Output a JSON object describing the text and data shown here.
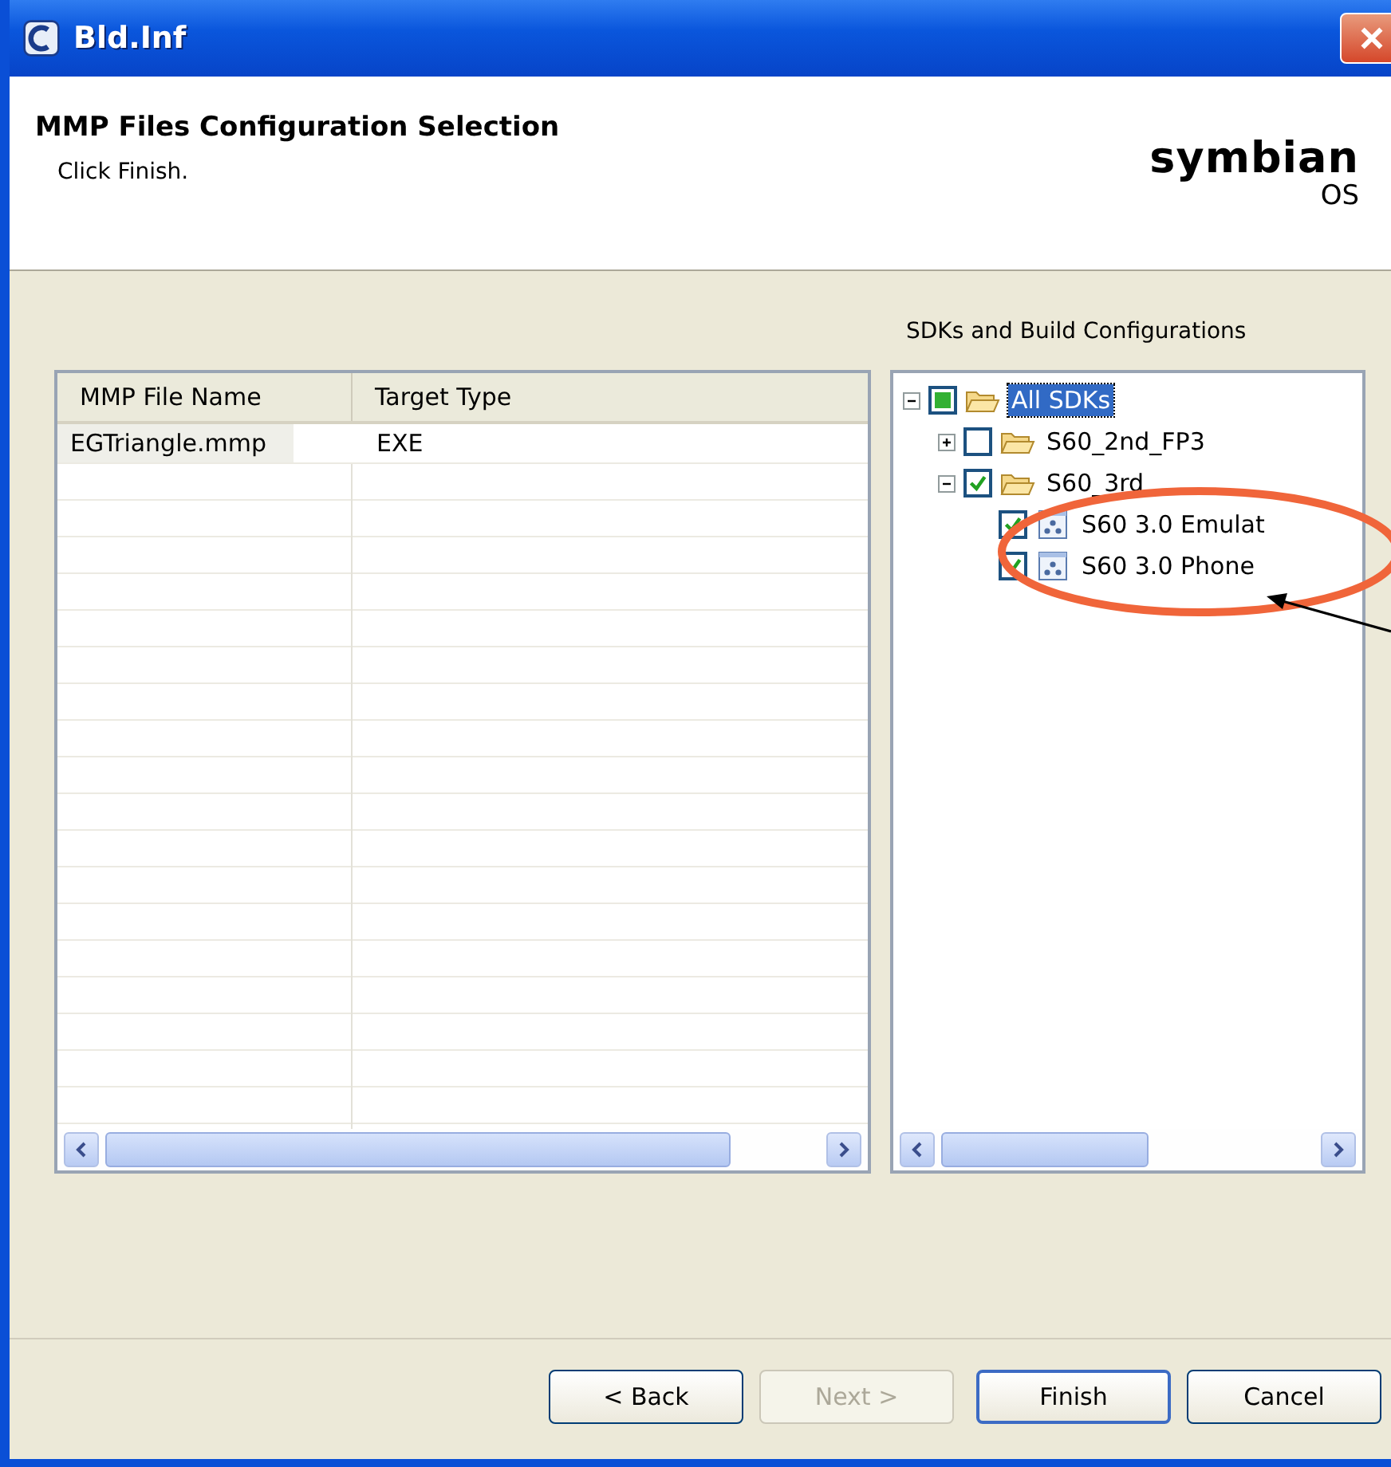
{
  "window": {
    "title": "Bld.Inf"
  },
  "header": {
    "title": "MMP Files Configuration Selection",
    "subtitle": "Click Finish.",
    "logo_main": "symbian",
    "logo_sub": "OS"
  },
  "table": {
    "columns": [
      "MMP File Name",
      "Target Type"
    ],
    "rows": [
      {
        "cells": [
          "EGTriangle.mmp",
          "EXE"
        ],
        "selected": false
      }
    ]
  },
  "tree": {
    "label": "SDKs and Build Configurations",
    "items": [
      {
        "label": "All SDKs",
        "kind": "folder",
        "checked": true,
        "mixed": true,
        "expanded": true,
        "selected": true,
        "children": [
          {
            "label": "S60_2nd_FP3",
            "kind": "folder",
            "checked": false,
            "expanded": false,
            "selected": false
          },
          {
            "label": "S60_3rd",
            "kind": "folder",
            "checked": true,
            "expanded": true,
            "selected": false,
            "children": [
              {
                "label": "S60 3.0 Emulat",
                "kind": "config",
                "checked": true,
                "selected": false
              },
              {
                "label": "S60 3.0 Phone",
                "kind": "config",
                "checked": true,
                "selected": false
              }
            ]
          }
        ]
      }
    ]
  },
  "buttons": [
    {
      "label": "< Back",
      "disabled": false,
      "default": false
    },
    {
      "label": "Next >",
      "disabled": true,
      "default": false
    },
    {
      "label": "Finish",
      "disabled": false,
      "default": true
    },
    {
      "label": "Cancel",
      "disabled": false,
      "default": false
    }
  ]
}
